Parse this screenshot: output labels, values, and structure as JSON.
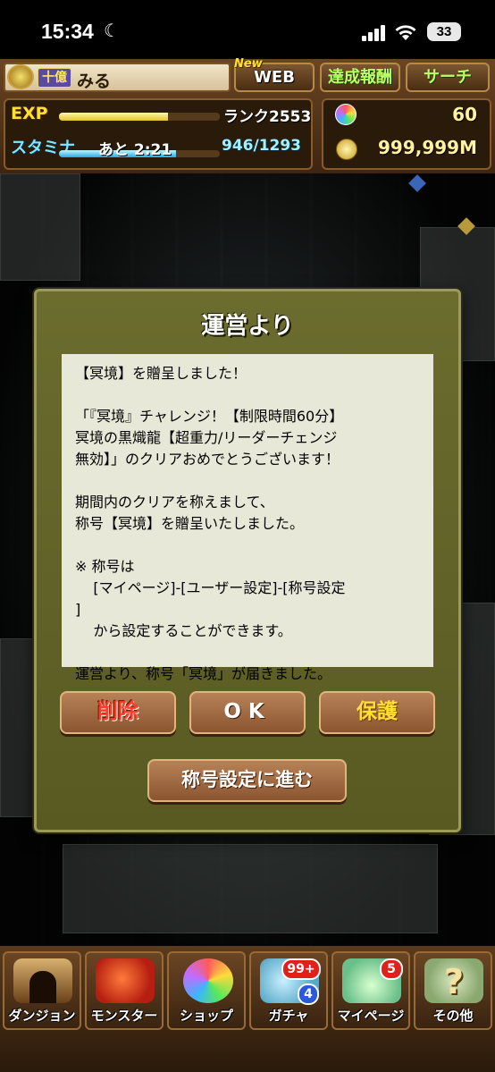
{
  "status_bar": {
    "time": "15:34",
    "moon": "☾",
    "battery": "33"
  },
  "header": {
    "rank_tag": "十億",
    "player_name": "みる",
    "new_tag": "New",
    "web_label": "WEB",
    "achievement_label": "達成報酬",
    "search_label": "サーチ",
    "exp_label": "EXP",
    "exp_fraction": 0.68,
    "rank_label": "ランク2553",
    "stamina_label": "スタミナ",
    "stamina_timer": "あと 2:21",
    "stamina_value": "946/1293",
    "stamina_fraction": 0.73,
    "magic_stones": "60",
    "coins": "999,999M"
  },
  "dialog": {
    "title": "運営より",
    "message": "【冥境】を贈呈しました！\n\n「『冥境』チャレンジ！【制限時間60分】\n冥境の黒熾龍【超重力/リーダーチェンジ\n無効】」のクリアおめでとうございます！\n\n期間内のクリアを称えまして、\n称号【冥境】を贈呈いたしました。\n\n※ 称号は\n    [マイページ]-[ユーザー設定]-[称号設定\n]\n    から設定することができます。\n\n運営より、称号「冥境」が届きました。",
    "delete_label": "削除",
    "ok_label": "OK",
    "protect_label": "保護",
    "goto_title_label": "称号設定に進む"
  },
  "bottom_nav": [
    {
      "label": "ダンジョン",
      "icon": "dungeon-gate-icon"
    },
    {
      "label": "モンスター",
      "icon": "dragon-icon"
    },
    {
      "label": "ショップ",
      "icon": "magic-stone-icon"
    },
    {
      "label": "ガチャ",
      "icon": "egg-machine-icon",
      "badge_top": "99+",
      "badge_bottom": "4"
    },
    {
      "label": "マイページ",
      "icon": "mascot-icon",
      "badge_top": "5"
    },
    {
      "label": "その他",
      "icon": "question-mark-icon"
    }
  ],
  "colors": {
    "dialog_bg": "#616329",
    "message_bg": "#e8e8d8",
    "delete_text": "#ff3b2b",
    "protect_text": "#ffe030"
  }
}
